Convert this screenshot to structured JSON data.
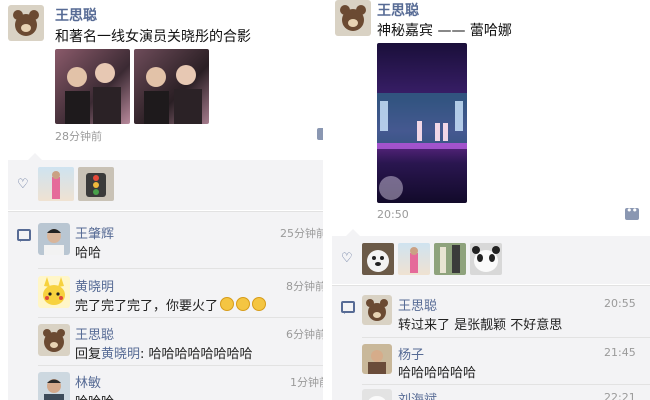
{
  "left": {
    "post": {
      "author": "王思聪",
      "text": "和著名一线女演员关晓彤的合影",
      "time": "28分钟前"
    },
    "comments": [
      {
        "name": "王肇辉",
        "text": "哈哈",
        "time": "25分钟前"
      },
      {
        "name": "黄晓明",
        "text": "完了完了完了，你要火了",
        "time": "8分钟前"
      },
      {
        "name": "王思聪",
        "reply_prefix": "回复",
        "reply_to": "黄晓明",
        "text": ": 哈哈哈哈哈哈哈哈",
        "time": "6分钟前"
      },
      {
        "name": "林敏",
        "text": "哈哈哈",
        "time": "1分钟前"
      }
    ]
  },
  "right": {
    "post": {
      "author": "王思聪",
      "text": "神秘嘉宾 —— 蕾哈娜",
      "time": "20:50"
    },
    "comments": [
      {
        "name": "王思聪",
        "text": "转过来了 是张靓颖 不好意思",
        "time": "20:55"
      },
      {
        "name": "杨子",
        "text": "哈哈哈哈哈哈",
        "time": "21:45"
      },
      {
        "name": "刘海斌",
        "text": "",
        "time": "22:21"
      }
    ]
  },
  "colors": {
    "name": "#576b95",
    "comment_bg": "#f3f3f5"
  }
}
